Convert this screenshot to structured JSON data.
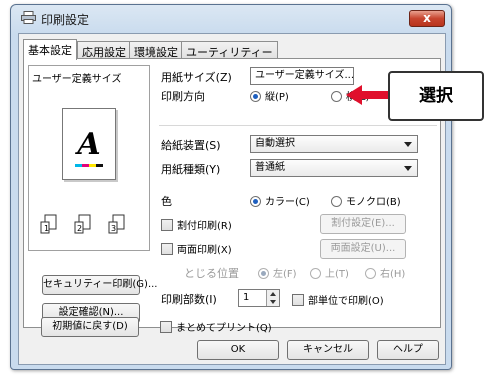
{
  "window": {
    "title": "印刷設定",
    "close_label": "x"
  },
  "tabs": [
    "基本設定",
    "応用設定",
    "環境設定",
    "ユーティリティー"
  ],
  "left": {
    "size_label": "ユーザー定義サイズ",
    "preview_letter": "A",
    "security_button": "セキュリティー印刷(G)...",
    "confirm_button": "設定確認(N)...",
    "reset_button": "初期値に戻す(D)"
  },
  "settings": {
    "paper_size": {
      "label": "用紙サイズ(Z)",
      "value": "ユーザー定義サイズ..."
    },
    "orientation": {
      "label": "印刷方向",
      "options": [
        "縦(P)",
        "横(L)"
      ],
      "selected": "縦(P)"
    },
    "source": {
      "label": "給紙装置(S)",
      "value": "自動選択"
    },
    "media": {
      "label": "用紙種類(Y)",
      "value": "普通紙"
    },
    "color": {
      "label": "色",
      "options": [
        "カラー(C)",
        "モノクロ(B)"
      ],
      "selected": "カラー(C)"
    },
    "split": {
      "label": "割付印刷(R)",
      "button": "割付設定(E)..."
    },
    "duplex": {
      "label": "両面印刷(X)",
      "button": "両面設定(U)..."
    },
    "binding": {
      "label": "とじる位置",
      "options": [
        "左(F)",
        "上(T)",
        "右(H)"
      ],
      "selected": "左(F)"
    },
    "copies": {
      "label": "印刷部数(I)",
      "value": "1",
      "collate_label": "部単位で印刷(O)"
    },
    "bulk": {
      "label": "まとめてプリント(Q)"
    }
  },
  "footer": {
    "ok": "OK",
    "cancel": "キャンセル",
    "help": "ヘルプ"
  },
  "callout": {
    "text": "選択"
  },
  "colors": {
    "accent_arrow": "#e0102c",
    "close_red": "#c7452f",
    "radio_blue": "#1e5fbf"
  }
}
